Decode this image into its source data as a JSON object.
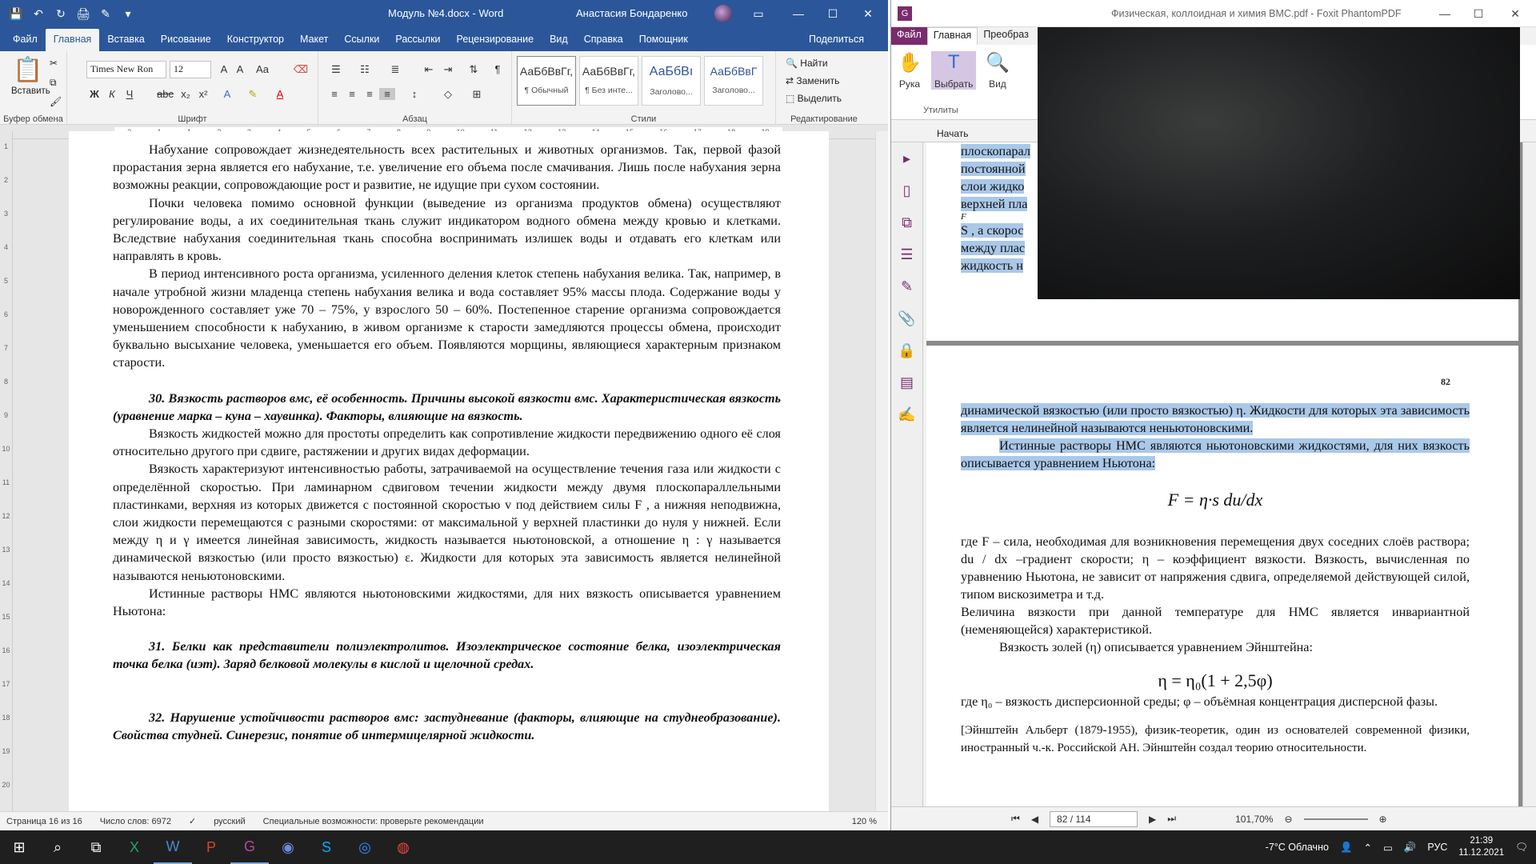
{
  "word": {
    "qat": [
      "💾",
      "↶",
      "↻",
      "🖨",
      "✎",
      "▾"
    ],
    "doc_title": "Модуль №4.docx  -  Word",
    "user": "Анастасия Бондаренко",
    "tabs": [
      "Файл",
      "Главная",
      "Вставка",
      "Рисование",
      "Конструктор",
      "Макет",
      "Ссылки",
      "Рассылки",
      "Рецензирование",
      "Вид",
      "Справка",
      "Помощник"
    ],
    "share": "Поделиться",
    "ribbon": {
      "paste": "Вставить",
      "font_name": "Times New Ron",
      "font_size": "12",
      "styles": [
        {
          "sample": "АаБбВвГг,",
          "name": "¶ Обычный"
        },
        {
          "sample": "АаБбВвГг,",
          "name": "¶ Без инте..."
        },
        {
          "sample": "АаБбВı",
          "name": "Заголово..."
        },
        {
          "sample": "АаБбВвГ",
          "name": "Заголово..."
        }
      ],
      "find": "Найти",
      "replace": "Заменить",
      "select": "Выделить",
      "groups": [
        "Буфер обмена",
        "Шрифт",
        "Абзац",
        "Стили",
        "Редактирование"
      ]
    },
    "ruler": [
      "2",
      "1",
      "1",
      "2",
      "3",
      "4",
      "5",
      "6",
      "7",
      "8",
      "9",
      "10",
      "11",
      "12",
      "13",
      "14",
      "15",
      "16",
      "17",
      "18",
      "19"
    ],
    "vruler": [
      "1",
      "2",
      "3",
      "4",
      "5",
      "6",
      "7",
      "8",
      "9",
      "10",
      "11",
      "12",
      "13",
      "14",
      "15",
      "16",
      "17",
      "18",
      "19",
      "20"
    ],
    "paragraphs": [
      {
        "type": "p",
        "text": "Набухание сопровождает жизнедеятельность всех растительных и животных организмов. Так, первой фазой прорастания зерна является его набухание, т.е. увеличение его объема после смачивания. Лишь после набухания зерна возможны реакции, сопровождающие рост и развитие, не идущие при сухом состоянии."
      },
      {
        "type": "p",
        "text": "Почки человека помимо основной функции (выведение из организма продуктов обмена) осуществляют регулирование воды, а их соединительная ткань служит индикатором водного обмена между кровью и клетками. Вследствие набухания соединительная ткань способна воспринимать излишек воды и отдавать его клеткам или направлять в кровь."
      },
      {
        "type": "p",
        "text": "В период интенсивного роста организма, усиленного деления клеток степень набухания велика. Так, например, в начале утробной жизни младенца степень набухания велика и вода составляет 95% массы плода. Содержание воды у новорожденного составляет уже 70 – 75%, у взрослого 50 – 60%. Постепенное старение организма сопровождается уменьшением способности к набуханию, в живом организме к старости замедляются процессы обмена, происходит буквально высыхание человека, уменьшается его объем. Появляются морщины, являющиеся характерным признаком старости."
      },
      {
        "type": "h",
        "text": "30. Вязкость растворов вмс, её особенность. Причины высокой вязкости вмс. Характеристическая вязкость (уравнение марка – куна – хаувинка). Факторы, влияющие на вязкость."
      },
      {
        "type": "p",
        "text": "Вязкость жидкостей можно для простоты определить как сопротивление жидкости передвижению одного её слоя относительно другого при сдвиге, растяжении и других видах деформации."
      },
      {
        "type": "p",
        "text": "Вязкость характеризуют интенсивностью работы, затрачиваемой на осуществление течения газа или жидкости с определённой скоростью. При ламинарном сдвиговом течении жидкости между двумя плоскопараллельными пластинками, верхняя из которых движется с постоянной скоростью v под действием силы F , а нижняя неподвижна, слои жидкости перемещаются с разными скоростями: от максимальной у верхней пластинки до нуля у нижней. Если между η и γ имеется линейная зависимость, жидкость называется ньютоновской, а отношение η : γ называется динамической вязкостью (или просто вязкостью) ε. Жидкости для которых эта зависимость является нелинейной называются неньютоновскими."
      },
      {
        "type": "p",
        "text": "Истинные растворы НМС являются ньютоновскими жидкостями, для них вязкость описывается уравнением Ньютона:"
      },
      {
        "type": "h",
        "text": "31. Белки как представители полиэлектролитов. Изоэлектрическое состояние белка, изоэлектрическая точка белка (иэт). Заряд белковой молекулы в кислой и щелочной средах."
      },
      {
        "type": "gap",
        "text": ""
      },
      {
        "type": "h",
        "text": "32. Нарушение устойчивости растворов вмс: застудневание (факторы, влияющие на студнеобразование). Свойства студней. Синерезис, понятие об интермицелярной жидкости."
      }
    ],
    "status": {
      "page": "Страница 16 из 16",
      "words": "Число слов: 6972",
      "lang": "русский",
      "access": "Специальные возможности: проверьте рекомендации",
      "zoom": "120 %"
    }
  },
  "pdf": {
    "title": "Физическая, коллоидная и химия ВМС.pdf - Foxit PhantomPDF",
    "tabs": [
      "Файл",
      "Главная",
      "Преобраз"
    ],
    "tools": [
      {
        "icon": "✋",
        "label": "Рука"
      },
      {
        "icon": "T",
        "label": "Выбрать"
      },
      {
        "icon": "🔍",
        "label": "Вид"
      }
    ],
    "util_label": "Утилиты",
    "start_tab": "Начать",
    "page1_lines": [
      "плоскопарал",
      "постоянной",
      "слои жидко",
      "верхней пла",
      "F",
      "S , а скорос",
      "между плас",
      "жидкость н"
    ],
    "page_number_top": "82",
    "page2": {
      "l1": "динамической вязкостью (или просто вязкостью) η. Жидкости для которых эта зависимость является нелинейной называются неньютоновскими.",
      "l2": "Истинные растворы НМС являются ньютоновскими жидкостями, для них вязкость описывается уравнением Ньютона:",
      "eq1": "F = η·s du/dx",
      "l3": "где F – сила, необходимая для возникновения перемещения двух соседних слоёв раствора; du / dx –градиент скорости; η – коэффициент вязкости. Вязкость, вычисленная по уравнению Ньютона, не зависит от напряжения сдвига, определяемой действующей силой, типом вискозиметра и т.д.",
      "l4": "Величина вязкости при данной температуре для НМС является инвариантной (неменяющейся) характеристикой.",
      "l5": "Вязкость золей (η) описывается уравнением Эйнштейна:",
      "eq2": "η = η₀(1 + 2,5φ)",
      "l6": "где η₀ – вязкость дисперсионной среды; φ – объёмная концентрация дисперсной фазы.",
      "l7": "[Эйнштейн Альберт (1879-1955), физик-теоретик, один из основателей современной физики, иностранный ч.-к. Российской АН. Эйнштейн создал теорию относительности."
    },
    "status": {
      "page": "82 / 114",
      "zoom": "101,70%"
    }
  },
  "taskbar": {
    "weather": "-7°C  Облачно",
    "lang": "РУС",
    "time": "21:39",
    "date": "11.12.2021"
  }
}
